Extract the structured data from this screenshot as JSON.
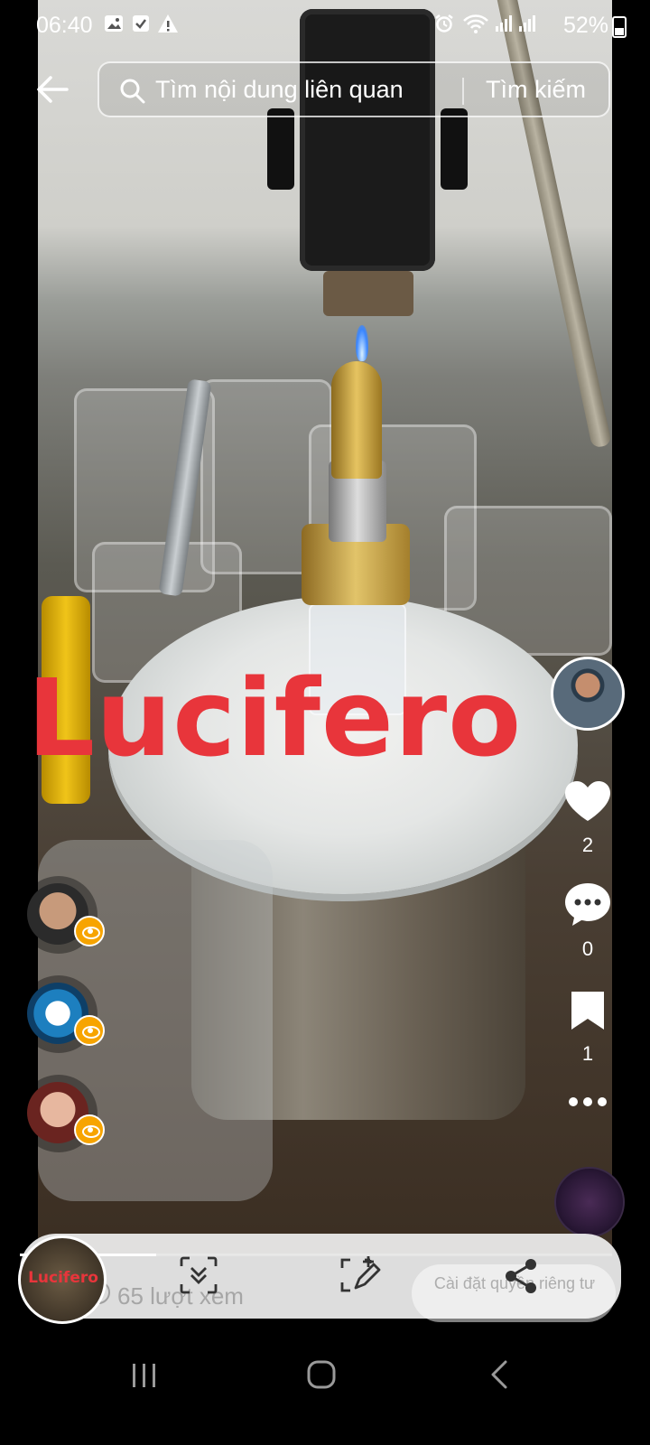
{
  "status_bar": {
    "time": "06:40",
    "battery": "52%",
    "icons": [
      "gallery-icon",
      "check-icon",
      "warning-icon",
      "alarm-icon",
      "wifi-icon",
      "signal-icon",
      "signal-icon"
    ]
  },
  "search": {
    "placeholder": "Tìm nội dung liên quan",
    "button_label": "Tìm kiếm"
  },
  "video": {
    "overlay_text": "Lucifero"
  },
  "actions": {
    "like_count": "2",
    "comment_count": "0",
    "save_count": "1"
  },
  "bottom": {
    "thumb_label": "Lucifero",
    "views": "65 lượt xem",
    "privacy_label": "Cài đặt quyền riêng tư",
    "progress": 0.23
  },
  "colors": {
    "overlay": "#e8353b",
    "viewer_badge": "#f7a400"
  }
}
